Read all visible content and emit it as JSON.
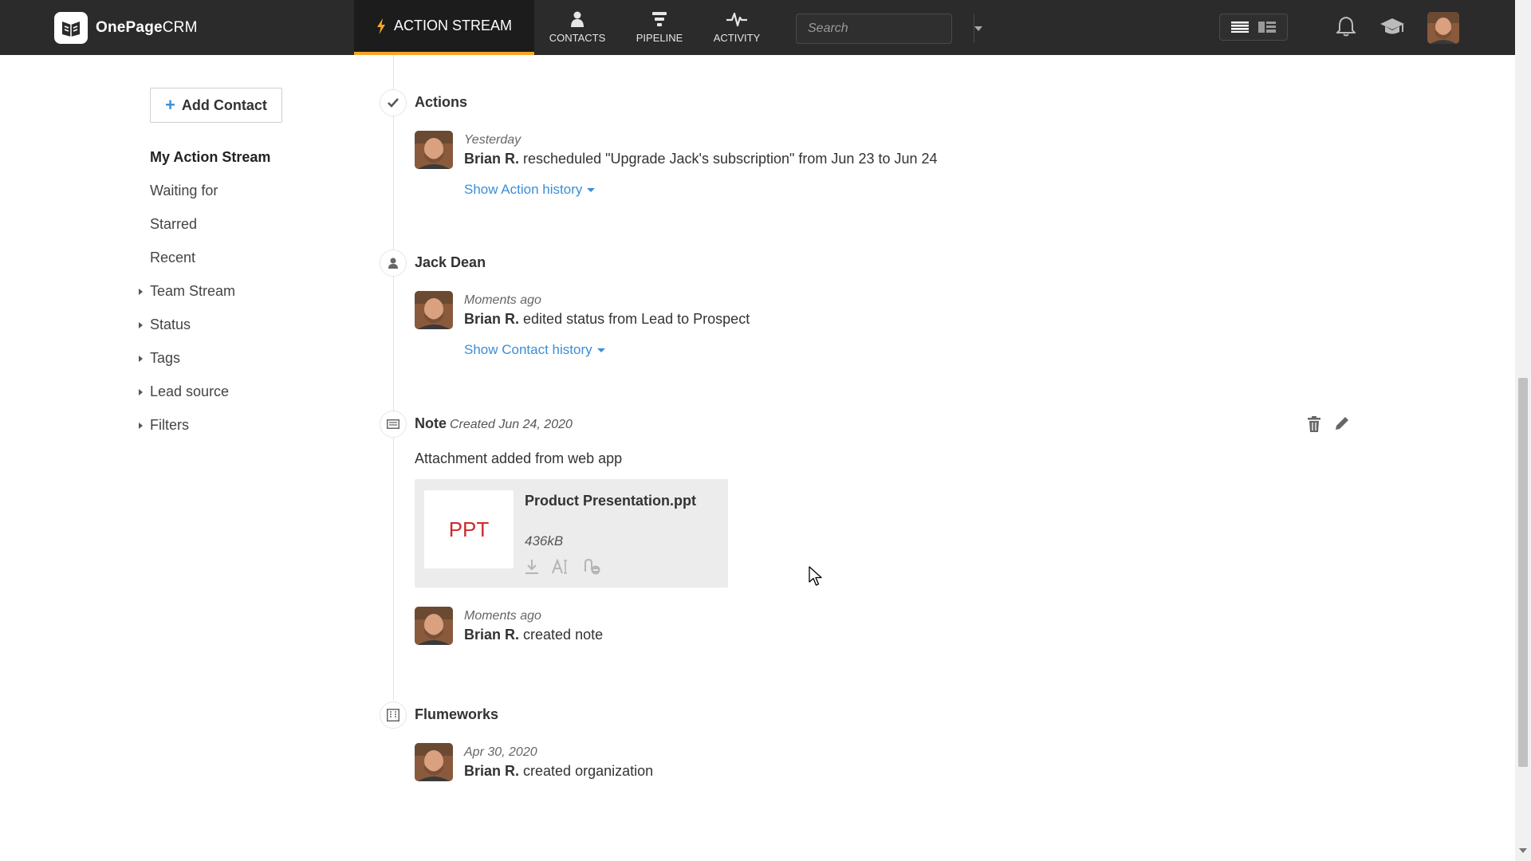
{
  "header": {
    "logo_text_bold": "OnePage",
    "logo_text_light": "CRM",
    "nav_active": "ACTION STREAM",
    "nav": [
      {
        "label": "CONTACTS",
        "icon": "person-icon"
      },
      {
        "label": "PIPELINE",
        "icon": "funnel-icon"
      },
      {
        "label": "ACTIVITY",
        "icon": "pulse-icon"
      }
    ],
    "search_placeholder": "Search",
    "accent_color": "#f5a623"
  },
  "sidebar": {
    "add_contact_label": "Add Contact",
    "items": [
      {
        "label": "My Action Stream",
        "active": true,
        "expandable": false
      },
      {
        "label": "Waiting for",
        "active": false,
        "expandable": false
      },
      {
        "label": "Starred",
        "active": false,
        "expandable": false
      },
      {
        "label": "Recent",
        "active": false,
        "expandable": false
      },
      {
        "label": "Team Stream",
        "active": false,
        "expandable": true
      },
      {
        "label": "Status",
        "active": false,
        "expandable": true
      },
      {
        "label": "Tags",
        "active": false,
        "expandable": true
      },
      {
        "label": "Lead source",
        "active": false,
        "expandable": true
      },
      {
        "label": "Filters",
        "active": false,
        "expandable": true
      }
    ]
  },
  "stream": {
    "actions": {
      "title": "Actions",
      "time": "Yesterday",
      "author": "Brian R.",
      "text": "rescheduled \"Upgrade Jack's subscription\" from Jun 23 to Jun 24",
      "history_link": "Show Action history"
    },
    "contact": {
      "title": "Jack Dean",
      "time": "Moments ago",
      "author": "Brian R.",
      "text": "edited status from Lead to Prospect",
      "history_link": "Show Contact history"
    },
    "note": {
      "title": "Note",
      "meta": "Created Jun 24, 2020",
      "body": "Attachment added from web app",
      "attachment": {
        "type_label": "PPT",
        "name": "Product Presentation.ppt",
        "size": "436kB"
      },
      "time": "Moments ago",
      "author": "Brian R.",
      "text": "created note"
    },
    "organization": {
      "title": "Flumeworks",
      "time": "Apr 30, 2020",
      "author": "Brian R.",
      "text": "created organization"
    }
  }
}
